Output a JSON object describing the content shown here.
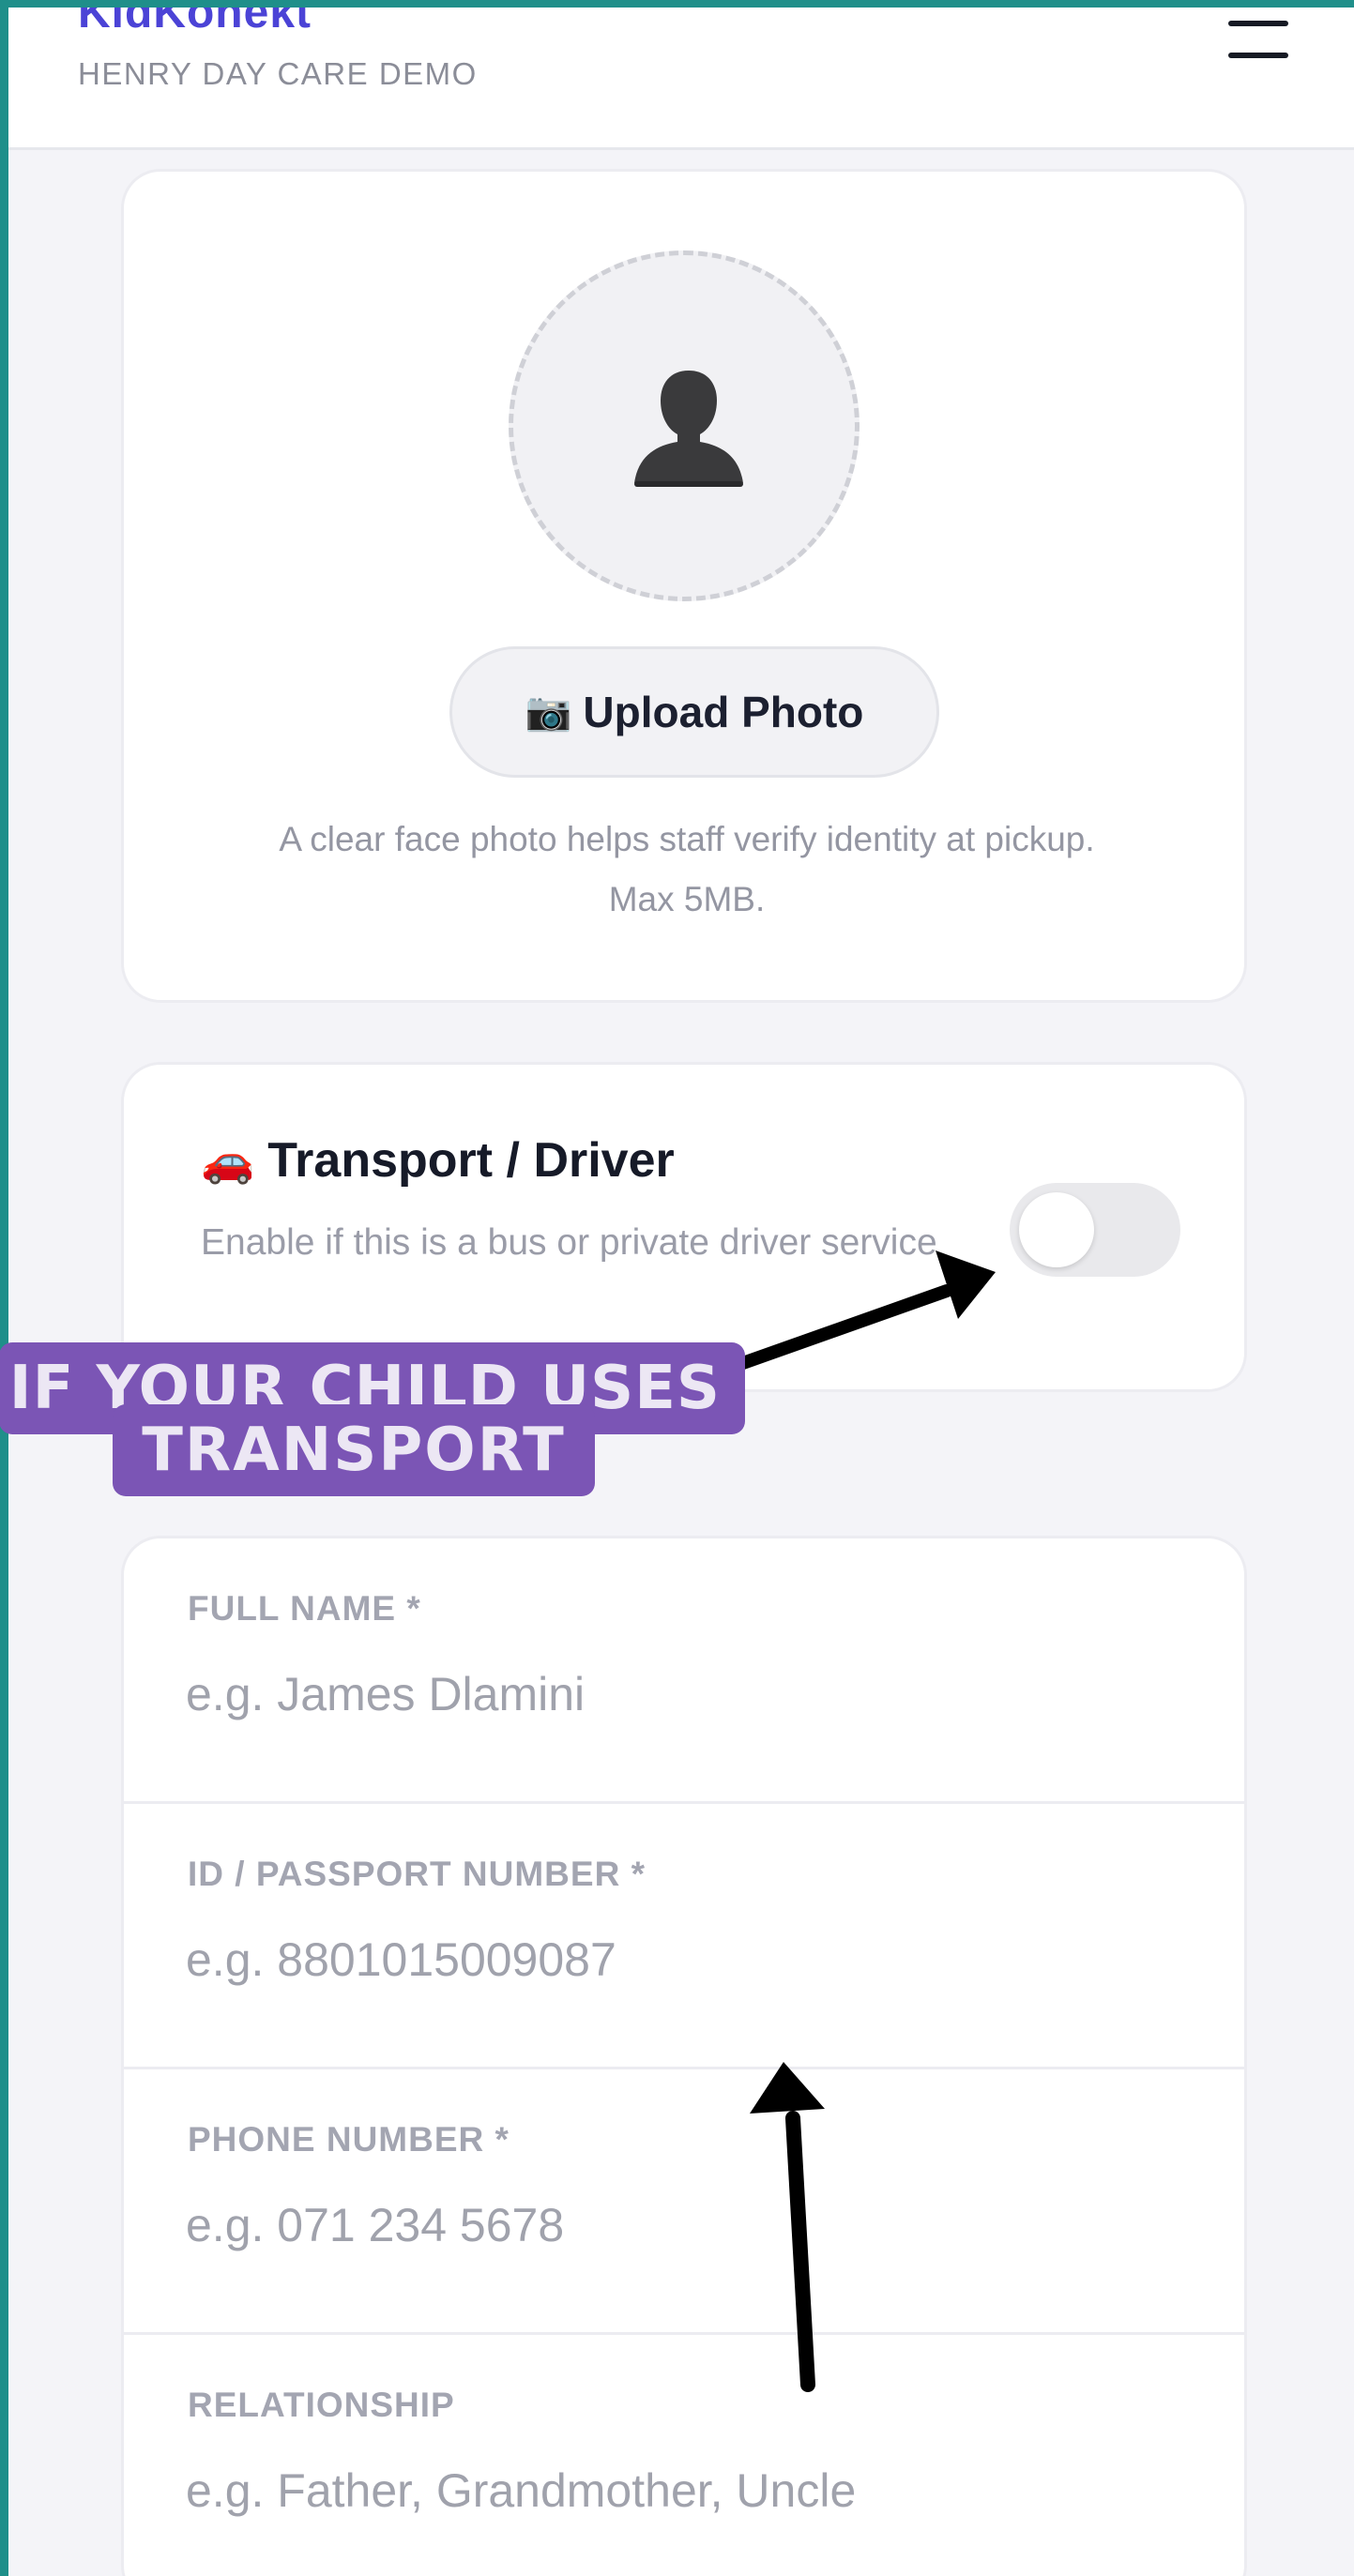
{
  "header": {
    "brand": "KidKonekt",
    "subtitle": "HENRY DAY CARE DEMO",
    "menu_icon": "hamburger-menu-icon"
  },
  "photo": {
    "avatar_icon": "person-silhouette-icon",
    "upload_icon": "camera-icon",
    "upload_label": "Upload Photo",
    "help_line1": "A clear face photo helps staff verify identity at pickup.",
    "help_line2": "Max 5MB."
  },
  "transport": {
    "icon": "car-icon",
    "title": "Transport / Driver",
    "description": "Enable if this is a bus or private driver service",
    "toggle_on": false
  },
  "annotation": {
    "line1": "IF YOUR CHILD USES",
    "line2": "TRANSPORT",
    "color": "#7b55b5"
  },
  "form": {
    "fields": [
      {
        "label": "FULL NAME *",
        "placeholder": "e.g. James Dlamini",
        "value": ""
      },
      {
        "label": "ID / PASSPORT NUMBER *",
        "placeholder": "e.g. 8801015009087",
        "value": ""
      },
      {
        "label": "PHONE NUMBER *",
        "placeholder": "e.g. 071 234 5678",
        "value": ""
      },
      {
        "label": "RELATIONSHIP",
        "placeholder": "e.g. Father, Grandmother, Uncle",
        "value": ""
      }
    ]
  },
  "colors": {
    "brand": "#4b43d6",
    "frame": "#1f8f8a",
    "background": "#f4f4f8"
  }
}
